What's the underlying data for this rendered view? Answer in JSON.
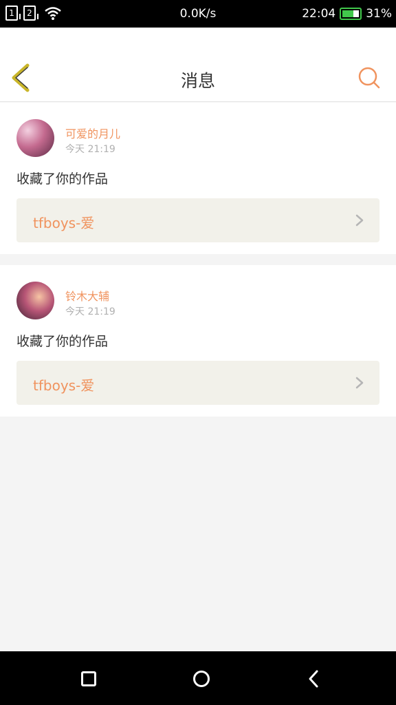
{
  "status_bar": {
    "sim1": "1",
    "sim2": "2",
    "network_speed": "0.0K/s",
    "time": "22:04",
    "battery": "31%",
    "battery_level": 0.31,
    "battery_color": "#41c84b"
  },
  "header": {
    "title": "消息",
    "back_icon": "chevron-left-icon",
    "search_icon": "search-icon"
  },
  "messages": [
    {
      "user_name": "可爱的月儿",
      "time": "今天 21:19",
      "action": "收藏了你的作品",
      "work_title": "tfboys-爱"
    },
    {
      "user_name": "铃木大辅",
      "time": "今天 21:19",
      "action": "收藏了你的作品",
      "work_title": "tfboys-爱"
    }
  ],
  "colors": {
    "accent": "#f0935e",
    "back_icon": "#c9b52a",
    "work_bg": "#f2f1ea"
  },
  "nav_bar": {
    "recent_icon": "square-icon",
    "home_icon": "circle-icon",
    "back_icon": "triangle-back-icon"
  }
}
